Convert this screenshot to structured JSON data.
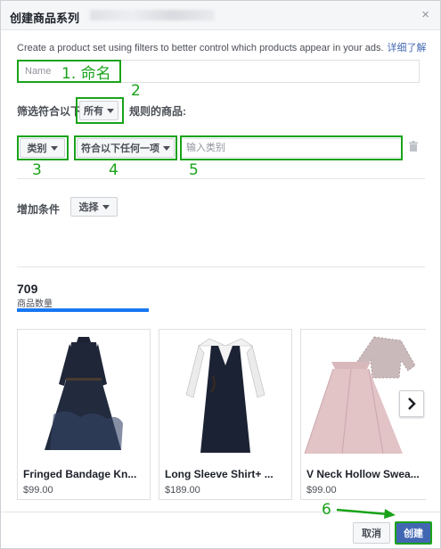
{
  "header": {
    "title": "创建商品系列",
    "close_glyph": "×"
  },
  "description": {
    "text": "Create a product set using filters to better control which products appear in your ads.",
    "link": "详细了解"
  },
  "name_input": {
    "placeholder": "Name",
    "value": ""
  },
  "filter": {
    "prefix": "筛选符合以下",
    "match_select": "所有",
    "suffix": "规则的商品:"
  },
  "rule": {
    "field_select": "类别",
    "operator_select": "符合以下任何一项",
    "value_placeholder": "输入类别"
  },
  "add_condition": {
    "label": "增加条件",
    "select_label": "选择"
  },
  "product_count": {
    "value": "709",
    "label": "商品数量",
    "fill_fraction": 1.0
  },
  "products": [
    {
      "name": "Fringed Bandage Kn...",
      "price": "$99.00"
    },
    {
      "name": "Long Sleeve Shirt+ ...",
      "price": "$189.00"
    },
    {
      "name": "V Neck Hollow Swea...",
      "price": "$99.00"
    }
  ],
  "footer": {
    "cancel_label": "取消",
    "create_label": "创建"
  },
  "annotations": {
    "a1": "1. 命名",
    "a2": "2",
    "a3": "3",
    "a4": "4",
    "a5": "5",
    "a6": "6"
  },
  "colors": {
    "accent": "#4267b2",
    "annotation_green": "#19a319",
    "progress": "#1877f2"
  }
}
